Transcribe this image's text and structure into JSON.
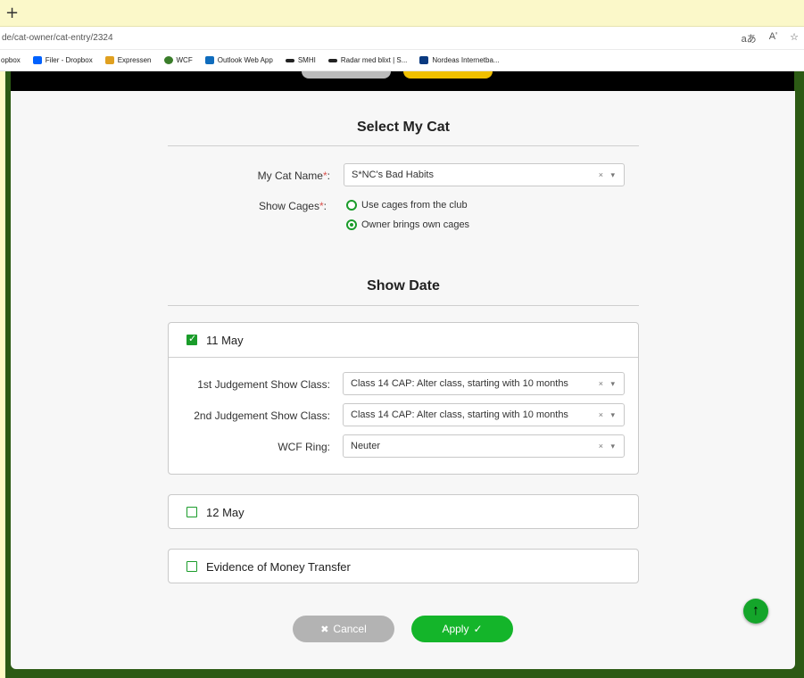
{
  "browser": {
    "new_tab": "+",
    "url": "de/cat-owner/cat-entry/2324",
    "addr_icons": [
      "aあ",
      "Aʹ",
      "☆"
    ],
    "bookmarks": [
      {
        "label": "opbox",
        "icon": "dropbox-icon",
        "color": ""
      },
      {
        "label": "Filer - Dropbox",
        "icon": "dropbox-icon",
        "color": "#0061fe"
      },
      {
        "label": "Expressen",
        "icon": "bird-icon",
        "color": "#e0a020"
      },
      {
        "label": "WCF",
        "icon": "cat-icon",
        "color": "#3a7d2a"
      },
      {
        "label": "Outlook Web App",
        "icon": "outlook-icon",
        "color": "#0f6cbd"
      },
      {
        "label": "SMHI",
        "icon": "smhi-icon",
        "color": "#222222"
      },
      {
        "label": "Radar med blixt | S...",
        "icon": "smhi-icon",
        "color": "#222222"
      },
      {
        "label": "Nordeas Internetba...",
        "icon": "nordea-icon",
        "color": "#0a3a80"
      }
    ]
  },
  "select_cat": {
    "title": "Select My Cat",
    "cat_name_label": "My Cat Name",
    "cat_name_value": "S*NC's Bad Habits",
    "show_cages_label": "Show Cages",
    "cage_options": [
      {
        "label": "Use cages from the club",
        "selected": false
      },
      {
        "label": "Owner brings own cages",
        "selected": true
      }
    ],
    "required_mark": "*",
    "colon": ":"
  },
  "show_date": {
    "title": "Show Date",
    "day1": {
      "label": "11 May",
      "checked": true,
      "fields": [
        {
          "label": "1st Judgement Show Class:",
          "value": "Class 14 CAP: Alter class, starting with 10 months"
        },
        {
          "label": "2nd Judgement Show Class:",
          "value": "Class 14 CAP: Alter class, starting with 10 months"
        },
        {
          "label": "WCF Ring:",
          "value": "Neuter"
        }
      ]
    },
    "day2": {
      "label": "12 May",
      "checked": false
    },
    "money": {
      "label": "Evidence of Money Transfer",
      "checked": false
    }
  },
  "select_controls": "× ▾",
  "actions": {
    "cancel_label": "Cancel",
    "cancel_icon": "✖",
    "apply_label": "Apply",
    "apply_icon": "✓",
    "scroll_top_icon": "↑"
  },
  "colors": {
    "accent": "#14b52a",
    "frame": "#2c5a14",
    "chrome": "#fbf8c9"
  }
}
